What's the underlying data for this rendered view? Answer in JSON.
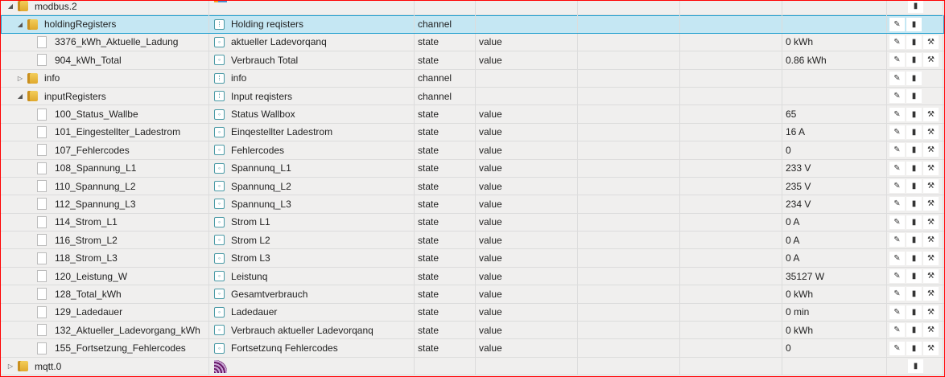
{
  "rows": [
    {
      "id": "modbus.2",
      "name": "",
      "type": "",
      "role": "",
      "value": "",
      "level": 0,
      "kind": "adapter",
      "toggle": "◢",
      "buttons": [
        "delete"
      ],
      "icon": "modbus-logo-icon"
    },
    {
      "id": "holdingRegisters",
      "name": "Holding reqisters",
      "type": "channel",
      "role": "",
      "value": "",
      "level": 1,
      "kind": "folder",
      "toggle": "◢",
      "buttons": [
        "edit",
        "delete"
      ],
      "selected": true
    },
    {
      "id": "3376_kWh_Aktuelle_Ladung",
      "name": "aktueller Ladevorqanq",
      "type": "state",
      "role": "value",
      "value": "0 kWh",
      "level": 2,
      "kind": "file",
      "buttons": [
        "edit",
        "delete",
        "settings"
      ]
    },
    {
      "id": "904_kWh_Total",
      "name": "Verbrauch Total",
      "type": "state",
      "role": "value",
      "value": "0.86 kWh",
      "level": 2,
      "kind": "file",
      "buttons": [
        "edit",
        "delete",
        "settings"
      ]
    },
    {
      "id": "info",
      "name": "info",
      "type": "channel",
      "role": "",
      "value": "",
      "level": 1,
      "kind": "folder",
      "toggle": "▷",
      "buttons": [
        "edit",
        "delete"
      ]
    },
    {
      "id": "inputRegisters",
      "name": "Input reqisters",
      "type": "channel",
      "role": "",
      "value": "",
      "level": 1,
      "kind": "folder",
      "toggle": "◢",
      "buttons": [
        "edit",
        "delete"
      ]
    },
    {
      "id": "100_Status_Wallbe",
      "name": "Status Wallbox",
      "type": "state",
      "role": "value",
      "value": "65",
      "level": 2,
      "kind": "file",
      "buttons": [
        "edit",
        "delete",
        "settings"
      ]
    },
    {
      "id": "101_Eingestellter_Ladestrom",
      "name": "Einqestellter Ladestrom",
      "type": "state",
      "role": "value",
      "value": "16 A",
      "level": 2,
      "kind": "file",
      "buttons": [
        "edit",
        "delete",
        "settings"
      ]
    },
    {
      "id": "107_Fehlercodes",
      "name": "Fehlercodes",
      "type": "state",
      "role": "value",
      "value": "0",
      "level": 2,
      "kind": "file",
      "buttons": [
        "edit",
        "delete",
        "settings"
      ]
    },
    {
      "id": "108_Spannung_L1",
      "name": "Spannunq_L1",
      "type": "state",
      "role": "value",
      "value": "233 V",
      "level": 2,
      "kind": "file",
      "buttons": [
        "edit",
        "delete",
        "settings"
      ]
    },
    {
      "id": "110_Spannung_L2",
      "name": "Spannunq_L2",
      "type": "state",
      "role": "value",
      "value": "235 V",
      "level": 2,
      "kind": "file",
      "buttons": [
        "edit",
        "delete",
        "settings"
      ]
    },
    {
      "id": "112_Spannung_L3",
      "name": "Spannunq_L3",
      "type": "state",
      "role": "value",
      "value": "234 V",
      "level": 2,
      "kind": "file",
      "buttons": [
        "edit",
        "delete",
        "settings"
      ]
    },
    {
      "id": "114_Strom_L1",
      "name": "Strom L1",
      "type": "state",
      "role": "value",
      "value": "0 A",
      "level": 2,
      "kind": "file",
      "buttons": [
        "edit",
        "delete",
        "settings"
      ]
    },
    {
      "id": "116_Strom_L2",
      "name": "Strom L2",
      "type": "state",
      "role": "value",
      "value": "0 A",
      "level": 2,
      "kind": "file",
      "buttons": [
        "edit",
        "delete",
        "settings"
      ]
    },
    {
      "id": "118_Strom_L3",
      "name": "Strom L3",
      "type": "state",
      "role": "value",
      "value": "0 A",
      "level": 2,
      "kind": "file",
      "buttons": [
        "edit",
        "delete",
        "settings"
      ]
    },
    {
      "id": "120_Leistung_W",
      "name": "Leistunq",
      "type": "state",
      "role": "value",
      "value": "35127 W",
      "level": 2,
      "kind": "file",
      "buttons": [
        "edit",
        "delete",
        "settings"
      ]
    },
    {
      "id": "128_Total_kWh",
      "name": "Gesamtverbrauch",
      "type": "state",
      "role": "value",
      "value": "0 kWh",
      "level": 2,
      "kind": "file",
      "buttons": [
        "edit",
        "delete",
        "settings"
      ]
    },
    {
      "id": "129_Ladedauer",
      "name": "Ladedauer",
      "type": "state",
      "role": "value",
      "value": "0 min",
      "level": 2,
      "kind": "file",
      "buttons": [
        "edit",
        "delete",
        "settings"
      ]
    },
    {
      "id": "132_Aktueller_Ladevorgang_kWh",
      "name": "Verbrauch aktueller Ladevorqanq",
      "type": "state",
      "role": "value",
      "value": "0 kWh",
      "level": 2,
      "kind": "file",
      "buttons": [
        "edit",
        "delete",
        "settings"
      ]
    },
    {
      "id": "155_Fortsetzung_Fehlercodes",
      "name": "Fortsetzunq Fehlercodes",
      "type": "state",
      "role": "value",
      "value": "0",
      "level": 2,
      "kind": "file",
      "buttons": [
        "edit",
        "delete",
        "settings"
      ]
    },
    {
      "id": "mqtt.0",
      "name": "",
      "type": "",
      "role": "",
      "value": "",
      "level": 0,
      "kind": "adapter",
      "toggle": "▷",
      "buttons": [
        "delete"
      ],
      "icon": "mqtt-logo-icon"
    }
  ],
  "button_glyphs": {
    "edit": "✎",
    "delete": "🗑",
    "settings": "🔧"
  }
}
